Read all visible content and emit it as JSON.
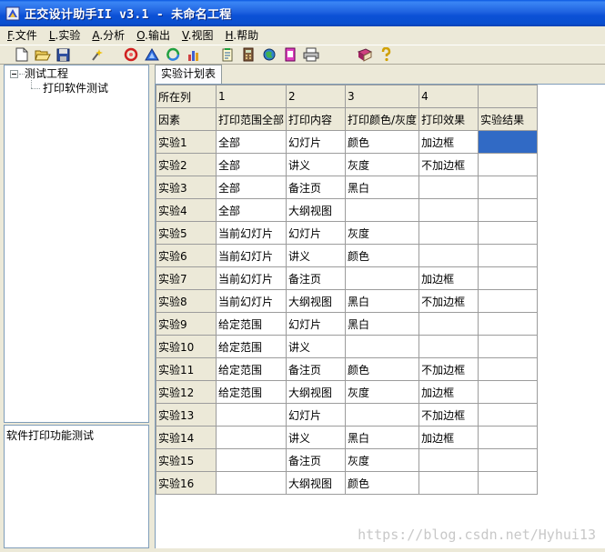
{
  "window": {
    "title": "正交设计助手II v3.1 - 未命名工程"
  },
  "menu": [
    {
      "mnemonic": "F",
      "label": ".文件"
    },
    {
      "mnemonic": "L",
      "label": ".实验"
    },
    {
      "mnemonic": "A",
      "label": ".分析"
    },
    {
      "mnemonic": "O",
      "label": ".输出"
    },
    {
      "mnemonic": "V",
      "label": ".视图"
    },
    {
      "mnemonic": "H",
      "label": ".帮助"
    }
  ],
  "toolbar": {
    "icons": [
      "new-file-icon",
      "open-folder-icon",
      "save-icon",
      "wizard-icon",
      "analysis-red-icon",
      "analysis-blue-icon",
      "recycle-icon",
      "bar-chart-icon",
      "notepad-icon",
      "calculator-icon",
      "globe-icon",
      "document-icon",
      "print-icon",
      "book-icon",
      "help-icon"
    ]
  },
  "tree": {
    "root": "测试工程",
    "child": "打印软件测试"
  },
  "description": "软件打印功能测试",
  "tab": {
    "label": "实验计划表"
  },
  "grid": {
    "header_row_1": [
      "所在列",
      "1",
      "2",
      "3",
      "4",
      ""
    ],
    "header_row_2": [
      "因素",
      "打印范围全部",
      "打印内容",
      "打印颜色/灰度",
      "打印效果",
      "实验结果"
    ],
    "rows": [
      [
        "实验1",
        "全部",
        "幻灯片",
        "颜色",
        "加边框",
        ""
      ],
      [
        "实验2",
        "全部",
        "讲义",
        "灰度",
        "不加边框",
        ""
      ],
      [
        "实验3",
        "全部",
        "备注页",
        "黑白",
        "",
        ""
      ],
      [
        "实验4",
        "全部",
        "大纲视图",
        "",
        "",
        ""
      ],
      [
        "实验5",
        "当前幻灯片",
        "幻灯片",
        "灰度",
        "",
        ""
      ],
      [
        "实验6",
        "当前幻灯片",
        "讲义",
        "颜色",
        "",
        ""
      ],
      [
        "实验7",
        "当前幻灯片",
        "备注页",
        "",
        "加边框",
        ""
      ],
      [
        "实验8",
        "当前幻灯片",
        "大纲视图",
        "黑白",
        "不加边框",
        ""
      ],
      [
        "实验9",
        "给定范围",
        "幻灯片",
        "黑白",
        "",
        ""
      ],
      [
        "实验10",
        "给定范围",
        "讲义",
        "",
        "",
        ""
      ],
      [
        "实验11",
        "给定范围",
        "备注页",
        "颜色",
        "不加边框",
        ""
      ],
      [
        "实验12",
        "给定范围",
        "大纲视图",
        "灰度",
        "加边框",
        ""
      ],
      [
        "实验13",
        "",
        "幻灯片",
        "",
        "不加边框",
        ""
      ],
      [
        "实验14",
        "",
        "讲义",
        "黑白",
        "加边框",
        ""
      ],
      [
        "实验15",
        "",
        "备注页",
        "灰度",
        "",
        ""
      ],
      [
        "实验16",
        "",
        "大纲视图",
        "颜色",
        "",
        ""
      ]
    ],
    "selected_color": "#316ac5"
  },
  "watermark": "https://blog.csdn.net/Hyhui13"
}
